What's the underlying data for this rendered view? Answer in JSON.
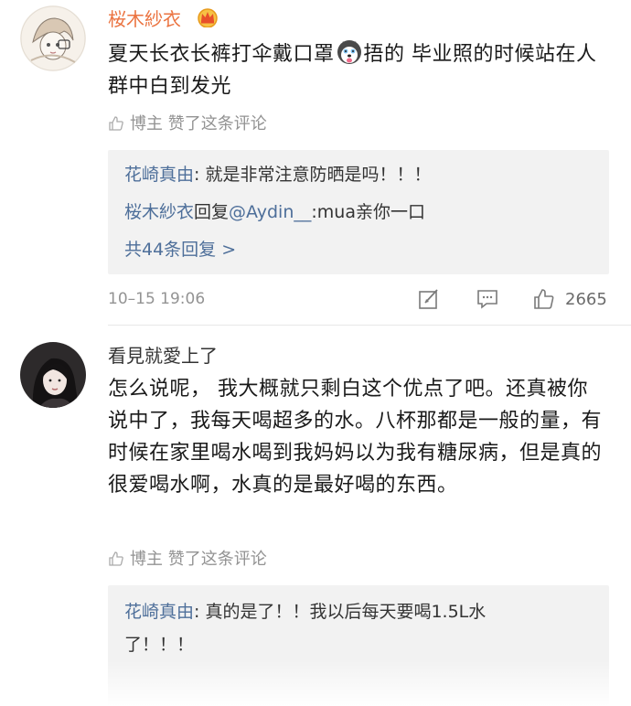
{
  "colors": {
    "vip_name": "#eb7340",
    "link": "#4e6f9a",
    "meta": "#939393",
    "reply_bg": "#f2f2f2"
  },
  "comments": [
    {
      "user": "桜木紗衣",
      "badge_icon": "crown-icon",
      "text_before_emoji": "夏天长衣长裤打伞戴口罩",
      "emoji_icon": "husky-emoji-icon",
      "text_after_emoji": "捂的 毕业照的时候站在人群中白到发光",
      "author_liked": "博主 赞了这条评论",
      "replies": [
        {
          "author": "花崎真由",
          "separator": ": ",
          "text": "就是非常注意防晒是吗！！！"
        },
        {
          "author": "桜木紗衣",
          "mid": "回复",
          "mention": "@Aydin__",
          "text": ":mua亲你一口"
        }
      ],
      "more_replies": "共44条回复 >",
      "time": "10–15 19:06",
      "likes": "2665"
    },
    {
      "user": "看見就愛上了",
      "text": "怎么说呢， 我大概就只剩白这个优点了吧。还真被你说中了，我每天喝超多的水。八杯那都是一般的量，有时候在家里喝水喝到我妈妈以为我有糖尿病，但是真的很爱喝水啊，水真的是最好喝的东西。",
      "author_liked": "博主 赞了这条评论",
      "replies": [
        {
          "author": "花崎真由",
          "separator": ": ",
          "text_line1": "真的是了！！我以后每天要喝1.5L水",
          "text_line2": "了！！！"
        }
      ]
    }
  ]
}
